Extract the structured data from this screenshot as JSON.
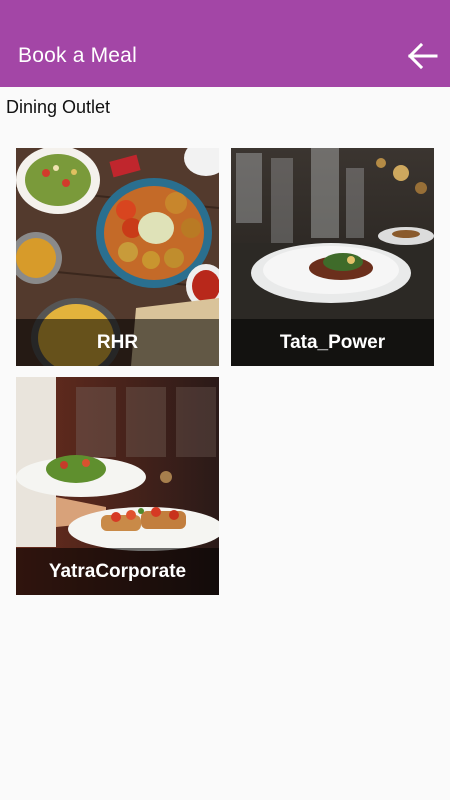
{
  "header": {
    "title": "Book a Meal",
    "back_icon": "arrow-left-icon",
    "background": "#a346a6"
  },
  "section": {
    "title": "Dining Outlet"
  },
  "outlets": [
    {
      "name": "RHR",
      "image": "indian-food-spread-photo"
    },
    {
      "name": "Tata_Power",
      "image": "plated-fine-dining-photo"
    },
    {
      "name": "YatraCorporate",
      "image": "waiter-serving-plates-photo"
    }
  ]
}
